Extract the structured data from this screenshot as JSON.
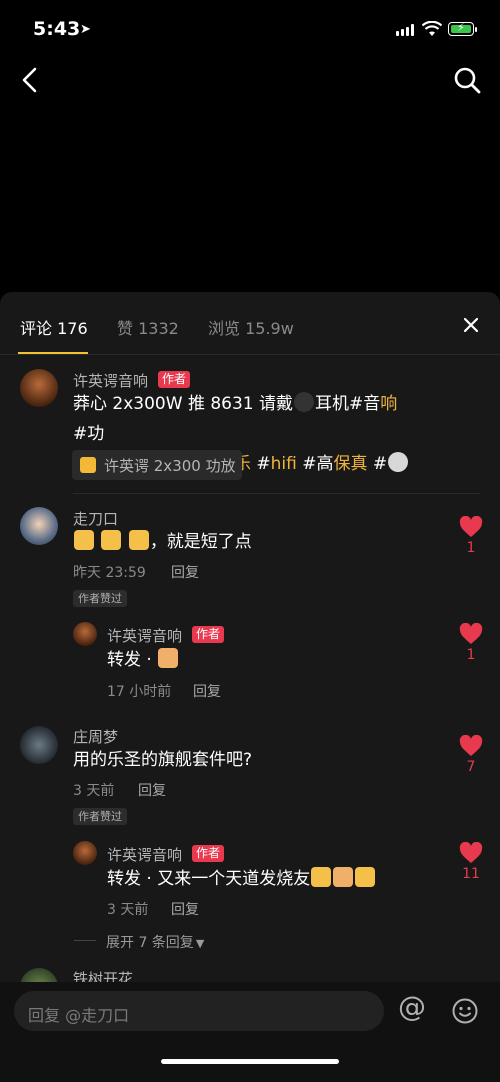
{
  "status_bar": {
    "time": "5:43"
  },
  "tabs": [
    {
      "label": "评论 176"
    },
    {
      "label": "赞 1332"
    },
    {
      "label": "浏览 15.9w"
    }
  ],
  "comments": [
    {
      "user": "许英谔音响",
      "badge": "作者",
      "text_lines": [
        [
          {
            "t": "莽心 2x300W 推 8631 请戴"
          },
          {
            "icon": "headphones"
          },
          {
            "t": "耳机#音"
          },
          {
            "t": "响",
            "hl": true
          },
          {
            "t": " #功"
          }
        ],
        [
          {
            "t": "放",
            "hl": true
          },
          {
            "t": " #音"
          },
          {
            "t": "箱",
            "hl": true
          },
          {
            "t": " #发"
          },
          {
            "t": "烧",
            "hl": true
          },
          {
            "t": " #音"
          },
          {
            "t": "乐",
            "hl": true
          },
          {
            "t": " #"
          },
          {
            "t": "hifi",
            "hl": true
          },
          {
            "t": " #高"
          },
          {
            "t": "保真",
            "hl": true
          },
          {
            "t": " #"
          },
          {
            "icon": "music"
          }
        ]
      ],
      "product": "许英谔 2x300 功放"
    },
    {
      "user": "走刀口",
      "text_suffix": "，就是短了点",
      "time": "昨天 23:59",
      "reply": "回复",
      "liked_badge": "作者赞过",
      "likes": "1"
    },
    {
      "user": "许英谔音响",
      "badge": "作者",
      "text": "转发 ·",
      "time": "17 小时前",
      "reply": "回复",
      "likes": "1"
    },
    {
      "user": "庄周梦",
      "text": "用的乐圣的旗舰套件吧?",
      "time": "3 天前",
      "reply": "回复",
      "liked_badge": "作者赞过",
      "likes": "7"
    },
    {
      "user": "许英谔音响",
      "badge": "作者",
      "text": "转发 · 又来一个天道发烧友",
      "time": "3 天前",
      "reply": "回复",
      "likes": "11"
    },
    {
      "user": "铁树开花"
    }
  ],
  "expand_replies": "展开 7 条回复",
  "input": {
    "placeholder": "回复 @走刀口",
    "at_symbol": "@"
  },
  "colors": {
    "accent_yellow": "#f2c330",
    "highlight": "#f0b43c",
    "heart_red": "#e8394f",
    "sheet_bg": "#181818"
  }
}
